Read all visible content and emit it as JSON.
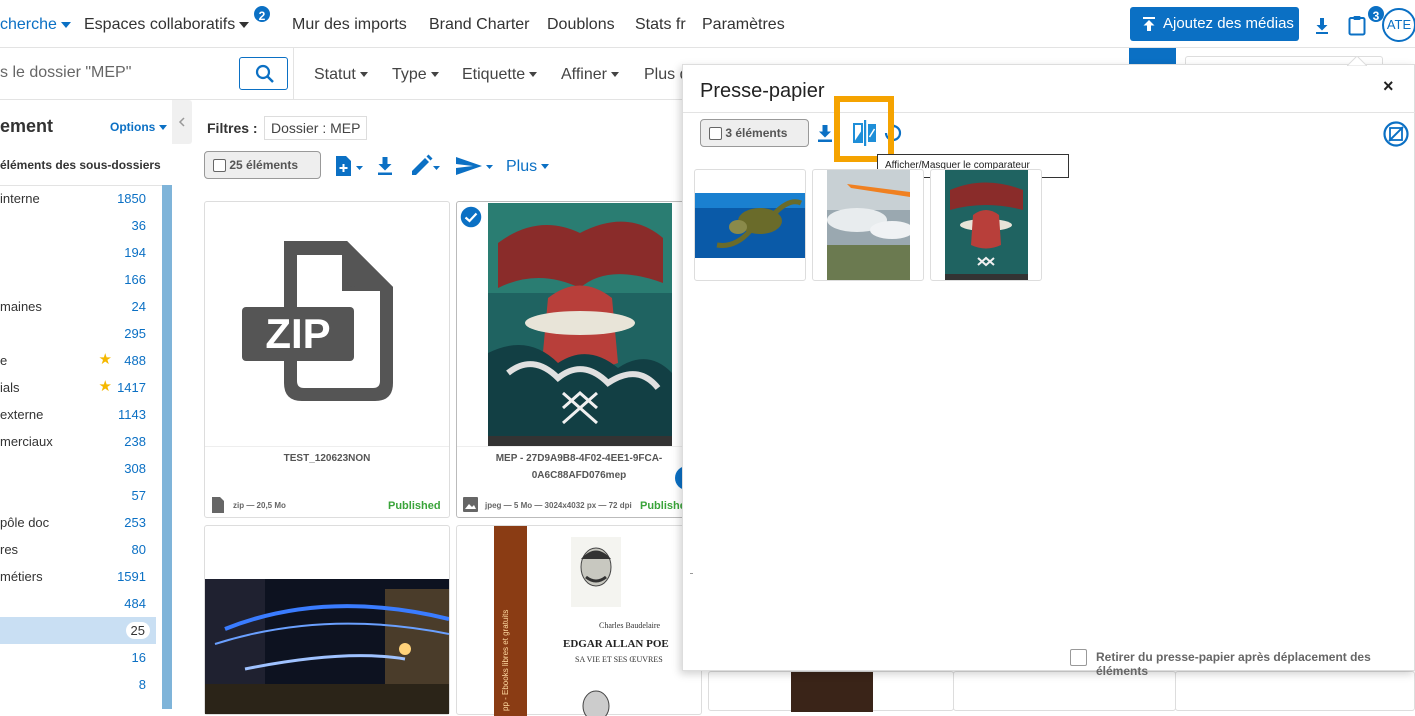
{
  "nav": {
    "items": [
      {
        "label": "cherche",
        "blue": true
      },
      {
        "label": "Espaces collaboratifs"
      },
      {
        "label": "Mur des imports"
      },
      {
        "label": "Brand Charter"
      },
      {
        "label": "Doublons"
      },
      {
        "label": "Stats fr"
      },
      {
        "label": "Paramètres"
      }
    ],
    "espaces_badge": "2",
    "add_media_label": "Ajoutez des médias",
    "clipboard_badge": "3",
    "avatar": "ATE"
  },
  "search": {
    "value": "s le dossier \"MEP\""
  },
  "filters": [
    "Statut",
    "Type",
    "Etiquette",
    "Affiner",
    "Plus d"
  ],
  "sidebar": {
    "title": "ement",
    "options_label": "Options",
    "subfolders_label": "éléments des sous-dossiers",
    "items": [
      {
        "label": "interne",
        "count": "1850",
        "star": false
      },
      {
        "label": "",
        "count": "36",
        "star": false
      },
      {
        "label": "",
        "count": "194",
        "star": false
      },
      {
        "label": "",
        "count": "166",
        "star": false
      },
      {
        "label": "maines",
        "count": "24",
        "star": false
      },
      {
        "label": "",
        "count": "295",
        "star": false
      },
      {
        "label": "e",
        "count": "488",
        "star": true
      },
      {
        "label": "ials",
        "count": "1417",
        "star": true
      },
      {
        "label": "externe",
        "count": "1143",
        "star": false
      },
      {
        "label": "merciaux",
        "count": "238",
        "star": false
      },
      {
        "label": "",
        "count": "308",
        "star": false
      },
      {
        "label": "",
        "count": "57",
        "star": false
      },
      {
        "label": "pôle doc",
        "count": "253",
        "star": false
      },
      {
        "label": "res",
        "count": "80",
        "star": false
      },
      {
        "label": "métiers",
        "count": "1591",
        "star": false
      },
      {
        "label": "",
        "count": "484",
        "star": false
      },
      {
        "label": "",
        "count": "25",
        "star": false,
        "active": true
      },
      {
        "label": "",
        "count": "16",
        "star": false
      },
      {
        "label": "",
        "count": "8",
        "star": false
      }
    ]
  },
  "main": {
    "filters_label": "Filtres :",
    "filter_chip": "Dossier : MEP",
    "count_label": "25 éléments",
    "plus_label": "Plus"
  },
  "cards": [
    {
      "name": "TEST_120623NON",
      "meta": "zip — 20,5 Mo",
      "status": "Published",
      "zip_text": "ZIP"
    },
    {
      "name": "MEP - 27D9A9B8-4F02-4EE1-9FCA-0A6C88AFD076mep",
      "meta": "jpeg — 5 Mo — 3024x4032 px — 72 dpi",
      "status": "Publishe"
    }
  ],
  "book": {
    "author": "Charles Baudelaire",
    "title": "EDGAR ALLAN POE",
    "subtitle": "SA VIE ET SES ŒUVRES",
    "spine": "pp - Ebooks libres et gratuits"
  },
  "panel": {
    "title": "Presse-papier",
    "close": "×",
    "count_label": "3 éléments",
    "tooltip": "Afficher/Masquer le comparateur",
    "retirer_label": "Retirer du presse-papier après déplacement des éléments"
  },
  "colors": {
    "primary": "#0b70c4",
    "highlight": "#f5a300",
    "published": "#3aa43a",
    "star": "#f5b800"
  }
}
